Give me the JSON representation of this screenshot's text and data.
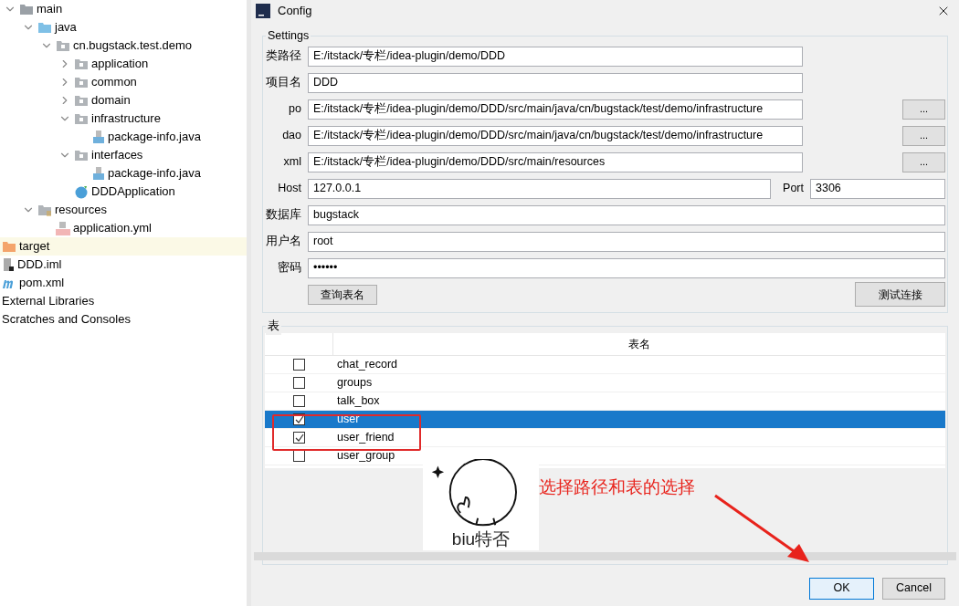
{
  "project_tree": [
    {
      "label": "main",
      "kind": "folder",
      "expanded": true,
      "selected": false,
      "children": [
        {
          "label": "java",
          "kind": "source_folder",
          "expanded": true,
          "selected": false,
          "children": [
            {
              "label": "cn.bugstack.test.demo",
              "kind": "package",
              "expanded": true,
              "selected": false,
              "children": [
                {
                  "label": "application",
                  "kind": "package",
                  "expanded": false,
                  "selected": false
                },
                {
                  "label": "common",
                  "kind": "package",
                  "expanded": false,
                  "selected": false
                },
                {
                  "label": "domain",
                  "kind": "package",
                  "expanded": false,
                  "selected": false
                },
                {
                  "label": "infrastructure",
                  "kind": "package",
                  "expanded": true,
                  "selected": false,
                  "children": [
                    {
                      "label": "package-info.java",
                      "kind": "java_file",
                      "selected": false
                    }
                  ]
                },
                {
                  "label": "interfaces",
                  "kind": "package",
                  "expanded": true,
                  "selected": false,
                  "children": [
                    {
                      "label": "package-info.java",
                      "kind": "java_file",
                      "selected": false
                    }
                  ]
                },
                {
                  "label": "DDDApplication",
                  "kind": "class",
                  "selected": false
                }
              ]
            }
          ]
        },
        {
          "label": "resources",
          "kind": "resources_folder",
          "expanded": true,
          "selected": false,
          "children": [
            {
              "label": "application.yml",
              "kind": "yml_file",
              "selected": false
            }
          ]
        }
      ]
    },
    {
      "label": "target",
      "kind": "excluded_folder",
      "selected": true
    },
    {
      "label": "DDD.iml",
      "kind": "iml_file",
      "selected": false
    },
    {
      "label": "pom.xml",
      "kind": "maven_file",
      "selected": false
    },
    {
      "label": "External Libraries",
      "kind": "none",
      "selected": false
    },
    {
      "label": "Scratches and Consoles",
      "kind": "none",
      "selected": false
    }
  ],
  "dialog": {
    "title": "Config",
    "settings": {
      "legend": "Settings",
      "fields": [
        {
          "kind": "plain",
          "label": "类路径",
          "value": "E:/itstack/专栏/idea-plugin/demo/DDD"
        },
        {
          "kind": "plain",
          "label": "项目名",
          "value": "DDD"
        },
        {
          "kind": "browse",
          "label": "po",
          "value": "E:/itstack/专栏/idea-plugin/demo/DDD/src/main/java/cn/bugstack/test/demo/infrastructure",
          "button": "..."
        },
        {
          "kind": "browse",
          "label": "dao",
          "value": "E:/itstack/专栏/idea-plugin/demo/DDD/src/main/java/cn/bugstack/test/demo/infrastructure",
          "button": "..."
        },
        {
          "kind": "browse",
          "label": "xml",
          "value": "E:/itstack/专栏/idea-plugin/demo/DDD/src/main/resources",
          "button": "..."
        },
        {
          "kind": "host_port",
          "label": "Host",
          "value": "127.0.0.1",
          "port_label": "Port",
          "port_value": "3306"
        },
        {
          "kind": "wide",
          "label": "数据库",
          "value": "bugstack"
        },
        {
          "kind": "wide",
          "label": "用户名",
          "value": "root"
        },
        {
          "kind": "wide",
          "label": "密码",
          "value": "••••••"
        }
      ],
      "query_button": "查询表名",
      "test_button": "测试连接"
    },
    "tables": {
      "legend": "表",
      "column_header": "表名",
      "rows": [
        {
          "name": "chat_record",
          "checked": false,
          "selected": false
        },
        {
          "name": "groups",
          "checked": false,
          "selected": false
        },
        {
          "name": "talk_box",
          "checked": false,
          "selected": false
        },
        {
          "name": "user",
          "checked": true,
          "selected": true
        },
        {
          "name": "user_friend",
          "checked": true,
          "selected": false
        },
        {
          "name": "user_group",
          "checked": false,
          "selected": false
        }
      ]
    },
    "buttons": [
      {
        "label": "OK",
        "default": true
      },
      {
        "label": "Cancel",
        "default": false
      }
    ]
  },
  "sticker": {
    "caption": "biu特否"
  },
  "annotation": {
    "text": "选择路径和表的选择"
  }
}
